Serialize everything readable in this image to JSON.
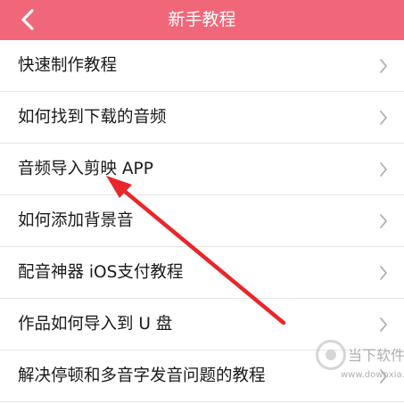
{
  "header": {
    "title": "新手教程",
    "back_icon": "chevron-left-icon",
    "color": "#f0677a"
  },
  "menu": {
    "items": [
      {
        "label": "快速制作教程"
      },
      {
        "label": "如何找到下载的音频"
      },
      {
        "label": "音频导入剪映 APP"
      },
      {
        "label": "如何添加背景音"
      },
      {
        "label": "配音神器 iOS支付教程"
      },
      {
        "label": "作品如何导入到 U 盘"
      },
      {
        "label": "解决停顿和多音字发音问题的教程"
      }
    ],
    "chevron_icon": "chevron-right-icon"
  },
  "annotation": {
    "arrow_color": "#e8262b"
  },
  "watermark": {
    "name": "当下软件园",
    "url": "www.downxia.com"
  }
}
